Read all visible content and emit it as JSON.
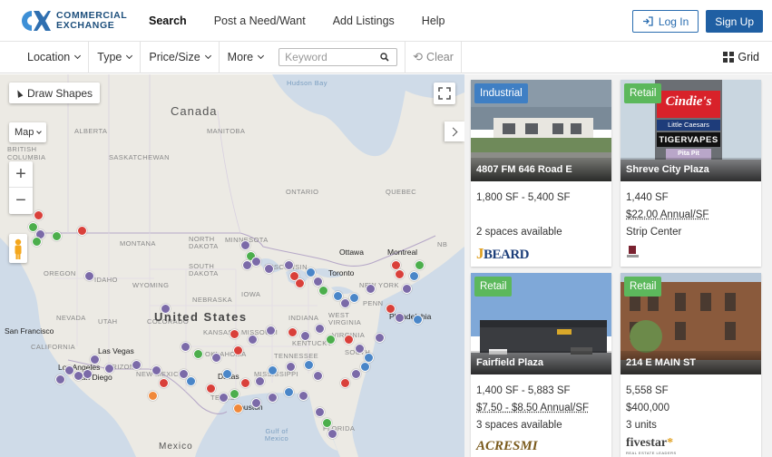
{
  "brand": {
    "line1": "COMMERCIAL",
    "line2": "EXCHANGE"
  },
  "nav": {
    "links": [
      {
        "label": "Search",
        "active": true
      },
      {
        "label": "Post a Need/Want",
        "active": false
      },
      {
        "label": "Add Listings",
        "active": false
      },
      {
        "label": "Help",
        "active": false
      }
    ],
    "login_label": "Log In",
    "signup_label": "Sign Up"
  },
  "filters": {
    "items": [
      "Location",
      "Type",
      "Price/Size",
      "More"
    ],
    "keyword_placeholder": "Keyword",
    "keyword_value": "",
    "clear_label": "Clear",
    "view_label": "Grid"
  },
  "map": {
    "draw_label": "Draw Shapes",
    "map_type_label": "Map",
    "zoom_in": "+",
    "zoom_out": "−",
    "labels": {
      "canada": "Canada",
      "usa": "United States",
      "mexico": "Mexico",
      "hudson_bay": "Hudson Bay",
      "alberta": "ALBERTA",
      "manitoba": "MANITOBA",
      "bc": "BRITISH COLUMBIA",
      "saskatchewan": "SASKATCHEWAN",
      "ontario": "ONTARIO",
      "quebec": "QUEBEC",
      "montana": "MONTANA",
      "nd": "NORTH DAKOTA",
      "sd": "SOUTH DAKOTA",
      "oregon": "OREGON",
      "idaho": "IDAHO",
      "wyoming": "WYOMING",
      "nevada": "NEVADA",
      "utah": "UTAH",
      "colorado": "COLORADO",
      "nebraska": "NEBRASKA",
      "kansas": "KANSAS",
      "iowa": "IOWA",
      "minnesota": "MINNESOTA",
      "wisconsin": "WISCONSIN",
      "california": "CALIFORNIA",
      "arizona": "ARIZONA",
      "new_mexico": "NEW MEXICO",
      "texas": "TEXAS",
      "oklahoma": "OKLAHOMA",
      "missouri": "MISSOURI",
      "mississippi": "MISSISSIPPI",
      "tennessee": "TENNESSEE",
      "indiana": "INDIANA",
      "kentucky": "KENTUCKY",
      "west_virginia": "WEST VIRGINIA",
      "virginia": "VIRGINIA",
      "south": "SOUTH",
      "penn": "PENN",
      "new_york": "NEW YORK",
      "nb": "NB",
      "florida": "FLORIDA",
      "gulf": "Gulf of Mexico",
      "san_francisco": "San Francisco",
      "las_vegas": "Las Vegas",
      "los_angeles": "Los Angeles",
      "san_diego": "San Diego",
      "ottawa": "Ottawa",
      "montreal": "Montreal",
      "toronto": "Toronto",
      "philadelphia": "Philadelphia",
      "houston": "Houston",
      "dallas": "Dallas"
    },
    "marker_colors": {
      "purple": "#7b6aa8",
      "red": "#d9403a",
      "green": "#4cae4c",
      "blue": "#4a86c8",
      "orange": "#f0883a",
      "gray": "#8a8aa0"
    }
  },
  "listings": [
    {
      "tag": "Industrial",
      "tag_color": "#3f7fc4",
      "title": "4807 FM 646 Road E",
      "line1": "1,800 SF - 5,400 SF",
      "line2": "",
      "line3": "2 spaces available",
      "logo": "BEARD"
    },
    {
      "tag": "Retail",
      "tag_color": "#5cb85c",
      "title": "Shreve City Plaza",
      "line1": "1,440 SF",
      "line2": "$22.00 Annual/SF",
      "line3": "Strip Center",
      "sign": {
        "brand": "Cindie's",
        "l1": "Little Caesars",
        "l2": "TIGERVAPES",
        "l3": "Pita Pit"
      }
    },
    {
      "tag": "Retail",
      "tag_color": "#5cb85c",
      "title": "Fairfield Plaza",
      "line1": "1,400 SF - 5,883 SF",
      "line2": "$7.50 - $8.50 Annual/SF",
      "line3": "3 spaces available",
      "logo": "ACRESMI"
    },
    {
      "tag": "Retail",
      "tag_color": "#5cb85c",
      "title": "214 E MAIN ST",
      "line1": "5,558 SF",
      "line2": "$400,000",
      "line3": "3 units",
      "logo": "fivestar",
      "logo_sub": "REAL ESTATE LEADERS"
    }
  ]
}
